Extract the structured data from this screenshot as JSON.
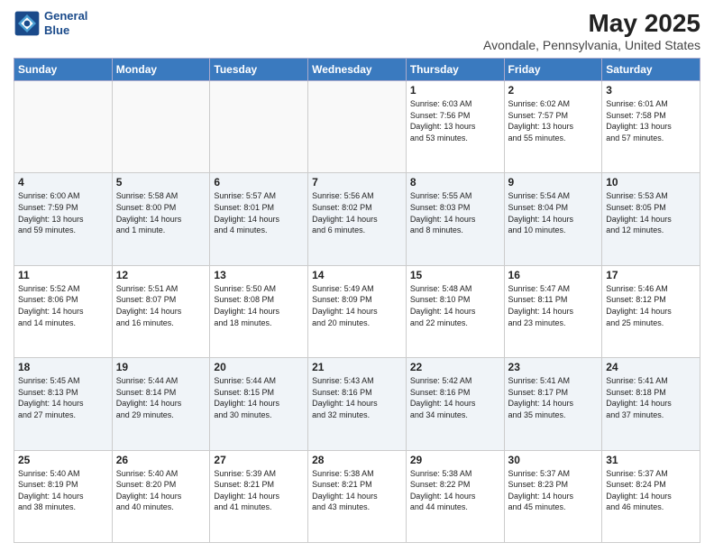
{
  "header": {
    "logo_line1": "General",
    "logo_line2": "Blue",
    "title": "May 2025",
    "subtitle": "Avondale, Pennsylvania, United States"
  },
  "weekdays": [
    "Sunday",
    "Monday",
    "Tuesday",
    "Wednesday",
    "Thursday",
    "Friday",
    "Saturday"
  ],
  "weeks": [
    [
      {
        "day": "",
        "info": ""
      },
      {
        "day": "",
        "info": ""
      },
      {
        "day": "",
        "info": ""
      },
      {
        "day": "",
        "info": ""
      },
      {
        "day": "1",
        "info": "Sunrise: 6:03 AM\nSunset: 7:56 PM\nDaylight: 13 hours\nand 53 minutes."
      },
      {
        "day": "2",
        "info": "Sunrise: 6:02 AM\nSunset: 7:57 PM\nDaylight: 13 hours\nand 55 minutes."
      },
      {
        "day": "3",
        "info": "Sunrise: 6:01 AM\nSunset: 7:58 PM\nDaylight: 13 hours\nand 57 minutes."
      }
    ],
    [
      {
        "day": "4",
        "info": "Sunrise: 6:00 AM\nSunset: 7:59 PM\nDaylight: 13 hours\nand 59 minutes."
      },
      {
        "day": "5",
        "info": "Sunrise: 5:58 AM\nSunset: 8:00 PM\nDaylight: 14 hours\nand 1 minute."
      },
      {
        "day": "6",
        "info": "Sunrise: 5:57 AM\nSunset: 8:01 PM\nDaylight: 14 hours\nand 4 minutes."
      },
      {
        "day": "7",
        "info": "Sunrise: 5:56 AM\nSunset: 8:02 PM\nDaylight: 14 hours\nand 6 minutes."
      },
      {
        "day": "8",
        "info": "Sunrise: 5:55 AM\nSunset: 8:03 PM\nDaylight: 14 hours\nand 8 minutes."
      },
      {
        "day": "9",
        "info": "Sunrise: 5:54 AM\nSunset: 8:04 PM\nDaylight: 14 hours\nand 10 minutes."
      },
      {
        "day": "10",
        "info": "Sunrise: 5:53 AM\nSunset: 8:05 PM\nDaylight: 14 hours\nand 12 minutes."
      }
    ],
    [
      {
        "day": "11",
        "info": "Sunrise: 5:52 AM\nSunset: 8:06 PM\nDaylight: 14 hours\nand 14 minutes."
      },
      {
        "day": "12",
        "info": "Sunrise: 5:51 AM\nSunset: 8:07 PM\nDaylight: 14 hours\nand 16 minutes."
      },
      {
        "day": "13",
        "info": "Sunrise: 5:50 AM\nSunset: 8:08 PM\nDaylight: 14 hours\nand 18 minutes."
      },
      {
        "day": "14",
        "info": "Sunrise: 5:49 AM\nSunset: 8:09 PM\nDaylight: 14 hours\nand 20 minutes."
      },
      {
        "day": "15",
        "info": "Sunrise: 5:48 AM\nSunset: 8:10 PM\nDaylight: 14 hours\nand 22 minutes."
      },
      {
        "day": "16",
        "info": "Sunrise: 5:47 AM\nSunset: 8:11 PM\nDaylight: 14 hours\nand 23 minutes."
      },
      {
        "day": "17",
        "info": "Sunrise: 5:46 AM\nSunset: 8:12 PM\nDaylight: 14 hours\nand 25 minutes."
      }
    ],
    [
      {
        "day": "18",
        "info": "Sunrise: 5:45 AM\nSunset: 8:13 PM\nDaylight: 14 hours\nand 27 minutes."
      },
      {
        "day": "19",
        "info": "Sunrise: 5:44 AM\nSunset: 8:14 PM\nDaylight: 14 hours\nand 29 minutes."
      },
      {
        "day": "20",
        "info": "Sunrise: 5:44 AM\nSunset: 8:15 PM\nDaylight: 14 hours\nand 30 minutes."
      },
      {
        "day": "21",
        "info": "Sunrise: 5:43 AM\nSunset: 8:16 PM\nDaylight: 14 hours\nand 32 minutes."
      },
      {
        "day": "22",
        "info": "Sunrise: 5:42 AM\nSunset: 8:16 PM\nDaylight: 14 hours\nand 34 minutes."
      },
      {
        "day": "23",
        "info": "Sunrise: 5:41 AM\nSunset: 8:17 PM\nDaylight: 14 hours\nand 35 minutes."
      },
      {
        "day": "24",
        "info": "Sunrise: 5:41 AM\nSunset: 8:18 PM\nDaylight: 14 hours\nand 37 minutes."
      }
    ],
    [
      {
        "day": "25",
        "info": "Sunrise: 5:40 AM\nSunset: 8:19 PM\nDaylight: 14 hours\nand 38 minutes."
      },
      {
        "day": "26",
        "info": "Sunrise: 5:40 AM\nSunset: 8:20 PM\nDaylight: 14 hours\nand 40 minutes."
      },
      {
        "day": "27",
        "info": "Sunrise: 5:39 AM\nSunset: 8:21 PM\nDaylight: 14 hours\nand 41 minutes."
      },
      {
        "day": "28",
        "info": "Sunrise: 5:38 AM\nSunset: 8:21 PM\nDaylight: 14 hours\nand 43 minutes."
      },
      {
        "day": "29",
        "info": "Sunrise: 5:38 AM\nSunset: 8:22 PM\nDaylight: 14 hours\nand 44 minutes."
      },
      {
        "day": "30",
        "info": "Sunrise: 5:37 AM\nSunset: 8:23 PM\nDaylight: 14 hours\nand 45 minutes."
      },
      {
        "day": "31",
        "info": "Sunrise: 5:37 AM\nSunset: 8:24 PM\nDaylight: 14 hours\nand 46 minutes."
      }
    ]
  ]
}
